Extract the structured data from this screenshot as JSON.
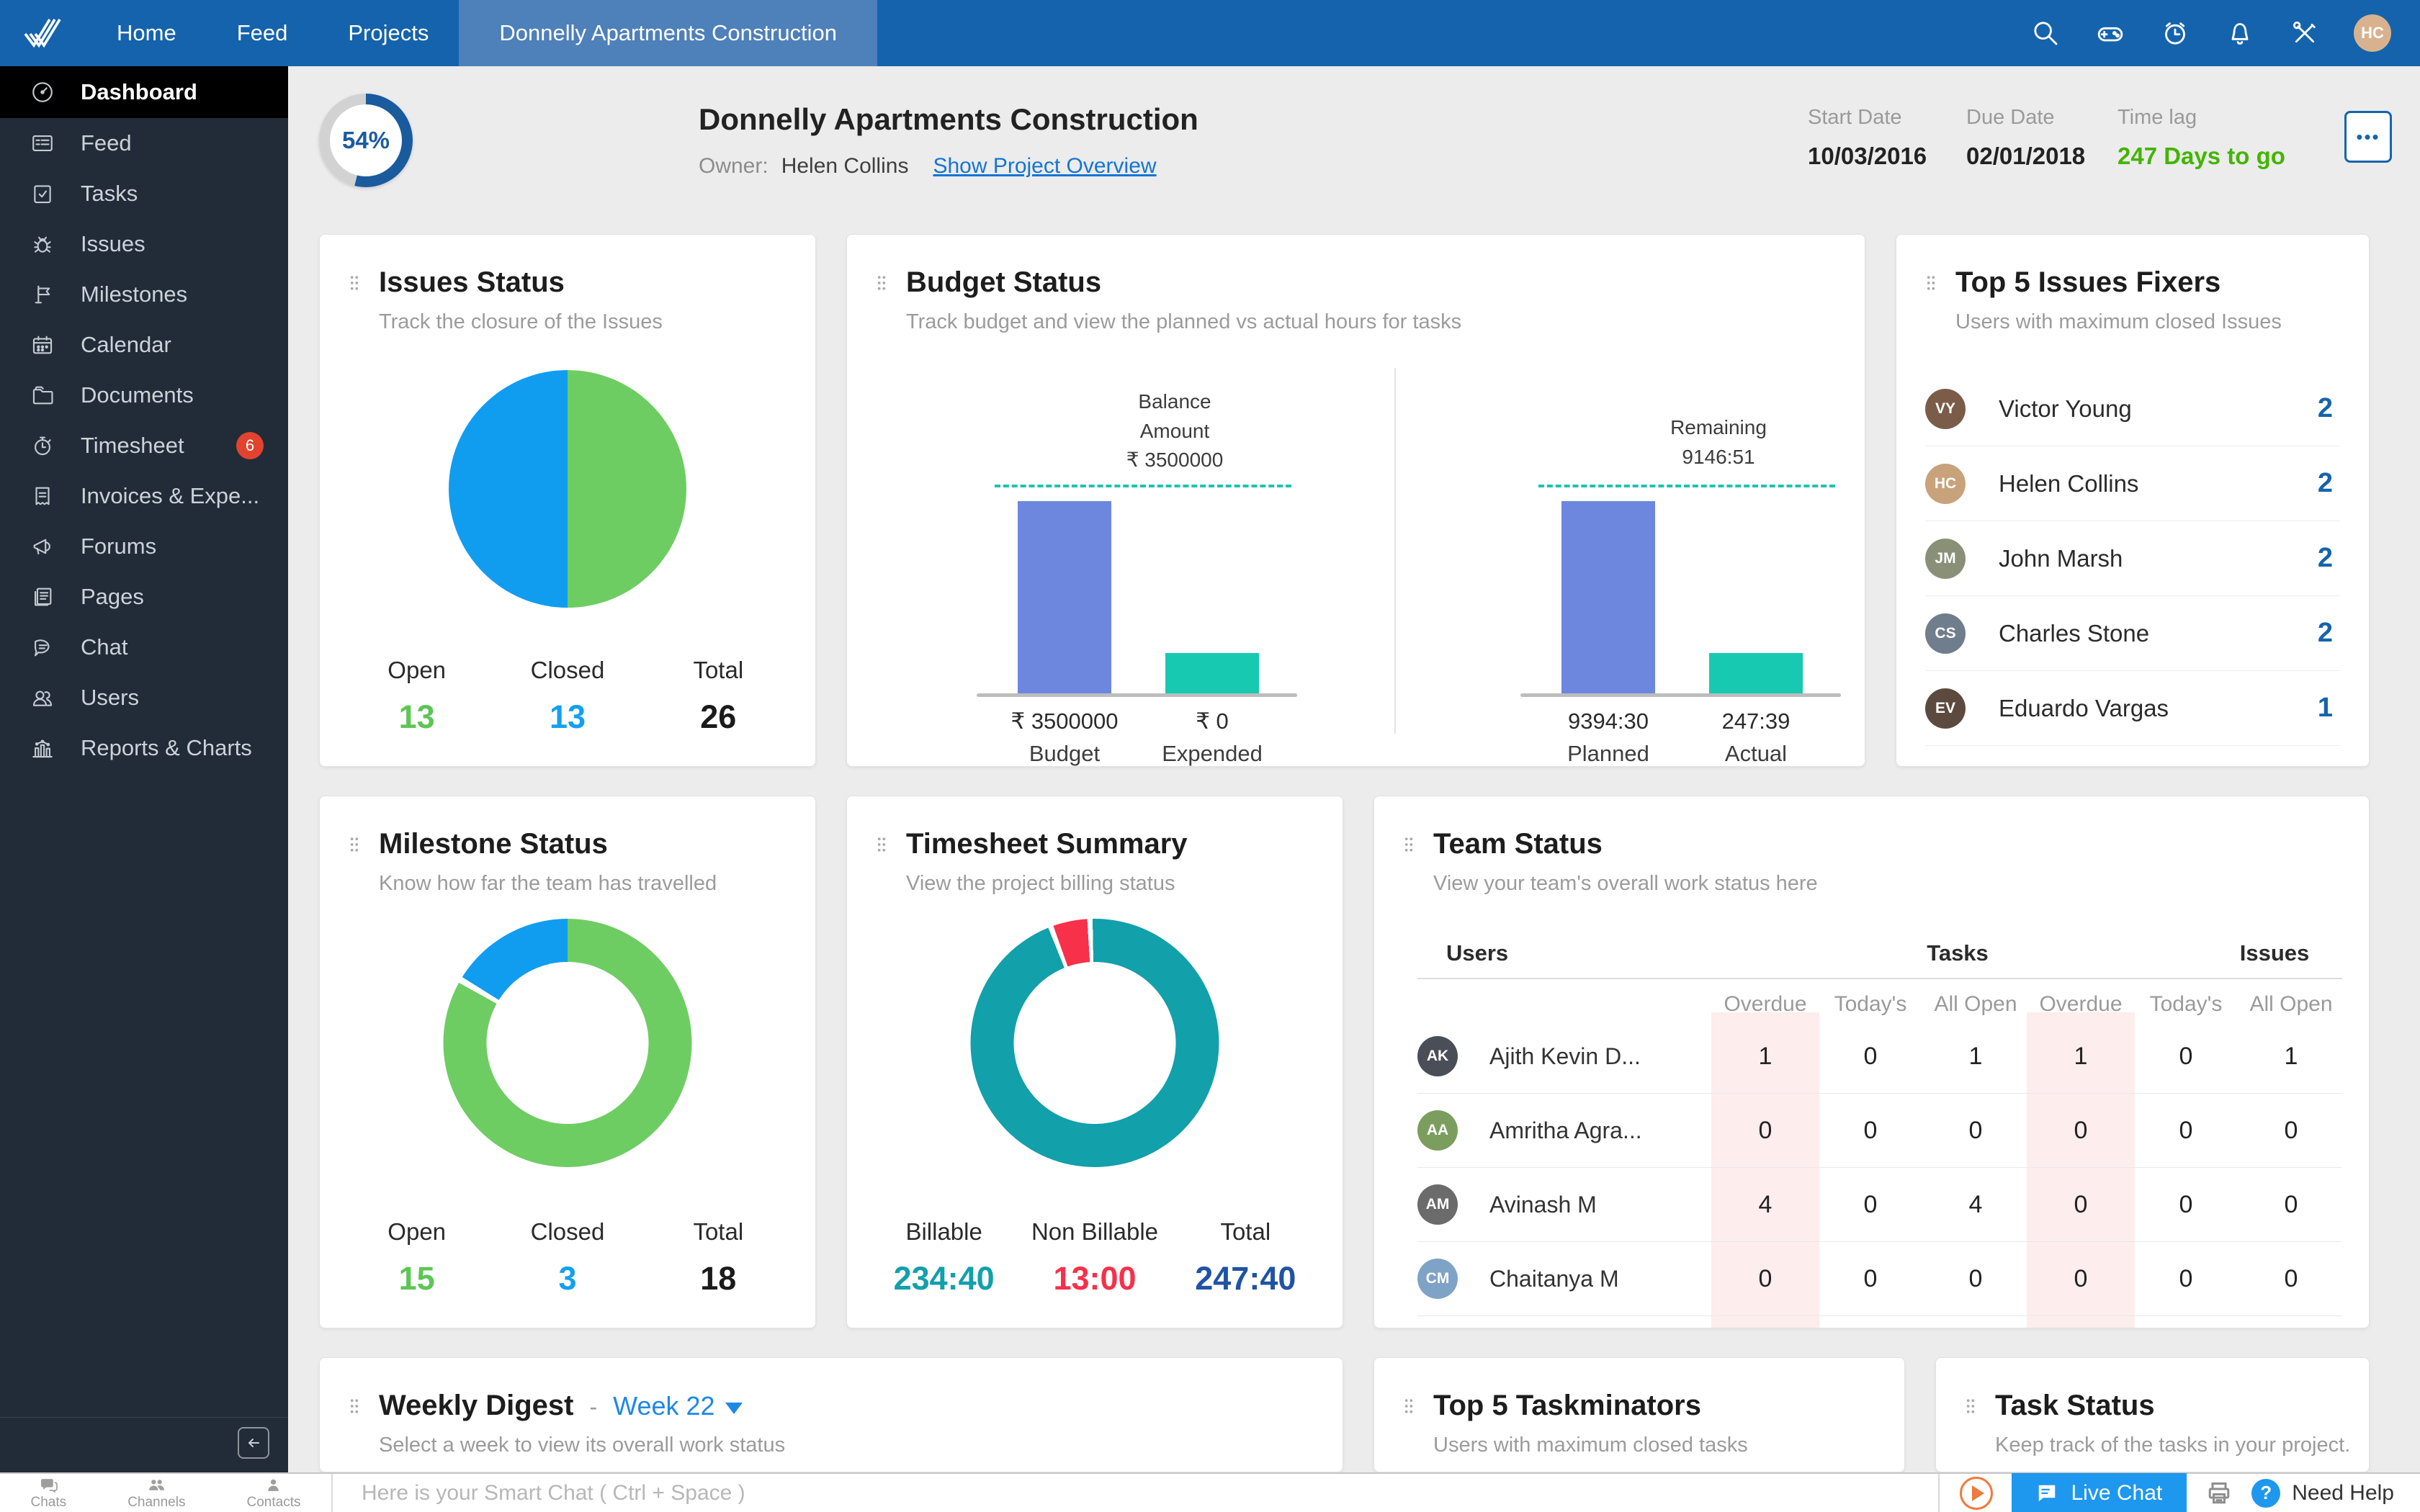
{
  "nav": {
    "tabs": [
      "Home",
      "Feed",
      "Projects"
    ],
    "active_tab": "Donnelly Apartments Construction",
    "avatar_initials": "HC"
  },
  "sidebar": {
    "items": [
      {
        "label": "Dashboard"
      },
      {
        "label": "Feed"
      },
      {
        "label": "Tasks"
      },
      {
        "label": "Issues"
      },
      {
        "label": "Milestones"
      },
      {
        "label": "Calendar"
      },
      {
        "label": "Documents"
      },
      {
        "label": "Timesheet",
        "badge": "6"
      },
      {
        "label": "Invoices & Expe..."
      },
      {
        "label": "Forums"
      },
      {
        "label": "Pages"
      },
      {
        "label": "Chat"
      },
      {
        "label": "Users"
      },
      {
        "label": "Reports & Charts"
      }
    ]
  },
  "header": {
    "progress": "54%",
    "title": "Donnelly Apartments Construction",
    "owner_label": "Owner:",
    "owner": "Helen Collins",
    "overview_link": "Show Project Overview",
    "start_date_label": "Start Date",
    "start_date": "10/03/2016",
    "due_date_label": "Due Date",
    "due_date": "02/01/2018",
    "time_lag_label": "Time lag",
    "time_lag": "247 Days to go",
    "more_label": "•••"
  },
  "issues_status": {
    "title": "Issues Status",
    "subtitle": "Track the closure of the Issues",
    "legend": [
      {
        "label": "Open",
        "value": "13"
      },
      {
        "label": "Closed",
        "value": "13"
      },
      {
        "label": "Total",
        "value": "26"
      }
    ]
  },
  "budget_status": {
    "title": "Budget Status",
    "subtitle": "Track budget and view the planned vs actual hours for tasks",
    "left": {
      "annotation_line1": "Balance",
      "annotation_line2": "Amount",
      "annotation_line3": "₹ 3500000",
      "bar1_value": "₹ 3500000",
      "bar1_label": "Budget",
      "bar2_value": "₹ 0",
      "bar2_label": "Expended"
    },
    "right": {
      "annotation_line1": "Remaining",
      "annotation_line2": "9146:51",
      "bar1_value": "9394:30",
      "bar1_label": "Planned",
      "bar2_value": "247:39",
      "bar2_label": "Actual"
    }
  },
  "issues_fixers": {
    "title": "Top 5 Issues Fixers",
    "subtitle": "Users with maximum closed Issues",
    "rows": [
      {
        "name": "Victor Young",
        "count": "2",
        "initials": "VY"
      },
      {
        "name": "Helen Collins",
        "count": "2",
        "initials": "HC"
      },
      {
        "name": "John Marsh",
        "count": "2",
        "initials": "JM"
      },
      {
        "name": "Charles Stone",
        "count": "2",
        "initials": "CS"
      },
      {
        "name": "Eduardo Vargas",
        "count": "1",
        "initials": "EV"
      }
    ]
  },
  "milestone_status": {
    "title": "Milestone Status",
    "subtitle": "Know how far the team has travelled",
    "legend": [
      {
        "label": "Open",
        "value": "15"
      },
      {
        "label": "Closed",
        "value": "3"
      },
      {
        "label": "Total",
        "value": "18"
      }
    ]
  },
  "timesheet_summary": {
    "title": "Timesheet Summary",
    "subtitle": "View the project billing status",
    "legend": [
      {
        "label": "Billable",
        "value": "234:40"
      },
      {
        "label": "Non Billable",
        "value": "13:00"
      },
      {
        "label": "Total",
        "value": "247:40"
      }
    ]
  },
  "team_status": {
    "title": "Team Status",
    "subtitle": "View your team's overall work status here",
    "col_users": "Users",
    "col_tasks": "Tasks",
    "col_issues": "Issues",
    "subheaders": [
      "Overdue",
      "Today's",
      "All Open",
      "Overdue",
      "Today's",
      "All Open"
    ],
    "rows": [
      {
        "name": "Ajith Kevin D...",
        "initials": "AK",
        "values": [
          "1",
          "0",
          "1",
          "1",
          "0",
          "1"
        ]
      },
      {
        "name": "Amritha Agra...",
        "initials": "AA",
        "values": [
          "0",
          "0",
          "0",
          "0",
          "0",
          "0"
        ]
      },
      {
        "name": "Avinash M",
        "initials": "AM",
        "values": [
          "4",
          "0",
          "4",
          "0",
          "0",
          "0"
        ]
      },
      {
        "name": "Chaitanya M",
        "initials": "CM",
        "values": [
          "0",
          "0",
          "0",
          "0",
          "0",
          "0"
        ]
      }
    ]
  },
  "weekly_digest": {
    "title": "Weekly Digest",
    "dash": "-",
    "week": "Week 22",
    "subtitle": "Select a week to view its overall work status"
  },
  "taskminators": {
    "title": "Top 5 Taskminators",
    "subtitle": "Users with maximum closed tasks"
  },
  "task_status": {
    "title": "Task Status",
    "subtitle": "Keep track of the tasks in your project."
  },
  "bottom_bar": {
    "chat_items": [
      "Chats",
      "Channels",
      "Contacts"
    ],
    "placeholder": "Here is your Smart Chat ( Ctrl + Space )",
    "live_chat": "Live Chat",
    "help_mark": "?",
    "need_help": "Need Help"
  },
  "colors": {
    "nav_blue": "#1563ac",
    "active_tab_blue": "#4e80ba",
    "sidebar_dark": "#222c38",
    "badge_red": "#e2432e",
    "green": "#6ecd62",
    "pie_blue": "#109df0",
    "bar_blue": "#6d87de",
    "bar_teal": "#17c9b0",
    "donut_teal": "#12a0ab",
    "red": "#f8304a",
    "count_blue": "#1464ab",
    "total_navy": "#2053a4",
    "days_green": "#43b500",
    "link_blue": "#1574d4",
    "overdue_pink": "#fdeded"
  },
  "chart_data": [
    {
      "type": "pie",
      "title": "Issues Status",
      "labels": [
        "Open",
        "Closed"
      ],
      "values": [
        13,
        13
      ],
      "colors": [
        "#6ecd62",
        "#109df0"
      ],
      "total": 26,
      "legend_position": "bottom"
    },
    {
      "type": "bar",
      "title": "Budget Status — money",
      "categories": [
        "Budget",
        "Expended"
      ],
      "values": [
        3500000,
        0
      ],
      "display_values": [
        "₹ 3500000",
        "₹ 0"
      ],
      "annotation": "Balance Amount ₹ 3500000",
      "colors": [
        "#6d87de",
        "#17c9b0"
      ]
    },
    {
      "type": "bar",
      "title": "Budget Status — hours",
      "categories": [
        "Planned",
        "Actual"
      ],
      "values": [
        "9394:30",
        "247:39"
      ],
      "annotation": "Remaining 9146:51",
      "colors": [
        "#6d87de",
        "#17c9b0"
      ]
    },
    {
      "type": "pie",
      "title": "Milestone Status (donut)",
      "labels": [
        "Open",
        "Closed"
      ],
      "values": [
        15,
        3
      ],
      "colors": [
        "#6ecd62",
        "#109df0"
      ],
      "total": 18
    },
    {
      "type": "pie",
      "title": "Timesheet Summary (donut)",
      "labels": [
        "Billable",
        "Non Billable"
      ],
      "values": [
        "234:40",
        "13:00"
      ],
      "colors": [
        "#12a0ab",
        "#f8304a"
      ],
      "total": "247:40"
    },
    {
      "type": "table",
      "title": "Team Status",
      "columns": [
        "Users",
        "Tasks Overdue",
        "Tasks Today's",
        "Tasks All Open",
        "Issues Overdue",
        "Issues Today's",
        "Issues All Open"
      ],
      "rows": [
        [
          "Ajith Kevin D...",
          1,
          0,
          1,
          1,
          0,
          1
        ],
        [
          "Amritha Agra...",
          0,
          0,
          0,
          0,
          0,
          0
        ],
        [
          "Avinash M",
          4,
          0,
          4,
          0,
          0,
          0
        ],
        [
          "Chaitanya M",
          0,
          0,
          0,
          0,
          0,
          0
        ]
      ]
    }
  ]
}
